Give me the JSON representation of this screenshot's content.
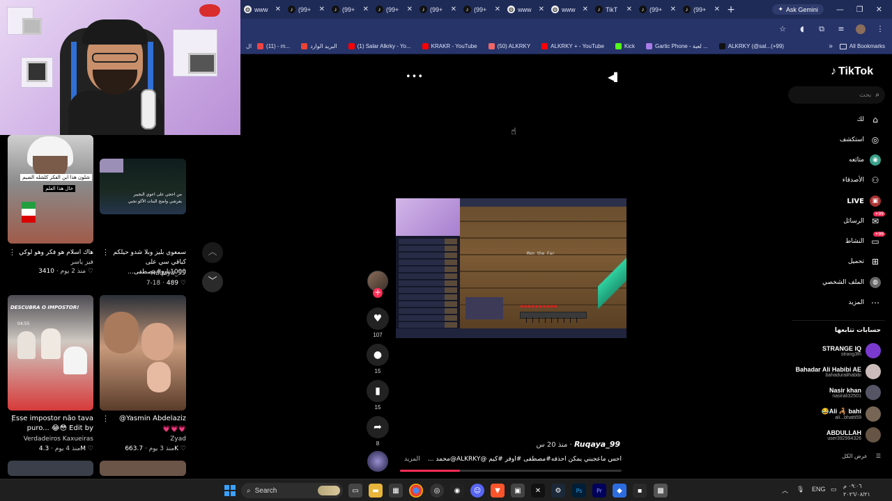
{
  "browser": {
    "tabs": [
      {
        "title": "www",
        "icon": "globe-icon"
      },
      {
        "title": "(99+",
        "icon": "tiktok-icon"
      },
      {
        "title": "(99+",
        "icon": "tiktok-icon"
      },
      {
        "title": "(99+",
        "icon": "tiktok-icon"
      },
      {
        "title": "(99+",
        "icon": "tiktok-icon"
      },
      {
        "title": "(99+",
        "icon": "tiktok-icon"
      },
      {
        "title": "www",
        "icon": "globe-icon"
      },
      {
        "title": "www",
        "icon": "globe-icon"
      },
      {
        "title": "TikT",
        "icon": "tiktok-icon"
      },
      {
        "title": "(99+",
        "icon": "tiktok-icon"
      },
      {
        "title": "(99+",
        "icon": "tiktok-icon"
      }
    ],
    "ask_gemini": "Ask Gemini",
    "bookmarks": [
      {
        "label": "(11) - m...",
        "color": "#e44"
      },
      {
        "label": "البريد الوارد",
        "color": "#ea4335"
      },
      {
        "label": "(1) Salar Alkrky - Yo...",
        "color": "#f00"
      },
      {
        "label": "KRAKR - YouTube",
        "color": "#f00"
      },
      {
        "label": "(50) ALKRKY",
        "color": "#e66"
      },
      {
        "label": "ALKRKY + - YouTube",
        "color": "#f00"
      },
      {
        "label": "Kick",
        "color": "#53fc18"
      },
      {
        "label": "Gartic Phone - لعبة ...",
        "color": "#a97be8"
      },
      {
        "label": "ALKRKY (@sal...(+99)",
        "color": "#111"
      }
    ],
    "all_bookmarks": "All Bookmarks"
  },
  "left_feed": {
    "cards": [
      {
        "thumb_text": [
          "شلون هذا ابن الفكر كلشله الضيم",
          "خال هذا العلم"
        ],
        "caption": "هاك اسلام هو فكر وهو لوكي",
        "sub": "فيز ياسر",
        "likes": "3410",
        "age": "منذ 2 يوم"
      },
      {
        "thumb_text": [
          "من احجي على اعوي البجيبر",
          "بفرشي واضح البنات الأكو نجبي"
        ],
        "caption": "سمعوي بليز وبلا شدو حيلكم كباقي سي على 1000تابع#مصطفى...",
        "author": "Ruqaya_99",
        "likes": "489",
        "age": "7-18"
      },
      {
        "thumb_text": [
          "DESCUBRA O IMPOSTOR!",
          "04:55"
        ],
        "caption": "Esse impostor não tava puro... 😂😳 Edit by",
        "author": "Verdadeiros Kaxueiras",
        "likes": "4.3M",
        "age": "منذ 4 يوم"
      },
      {
        "thumb_text": [],
        "caption": "Yasmin Abdelaziz@",
        "sub": "💗💗💗",
        "author": "Zyad",
        "likes": "663.7K",
        "age": "منذ 3 يوم"
      }
    ]
  },
  "video": {
    "game_text": "Mon the Far",
    "counts": {
      "likes": "107",
      "comments": "15",
      "saves": "15",
      "shares": "8"
    },
    "author": "Ruqaya_99",
    "age": "منذ 20 س",
    "caption": "احس ماعجبني يمكن احذفه#مصطفى #اوفر #كيم @ALKRKY@محمد ...",
    "more": "المزيد",
    "progress": 0.27
  },
  "tiktok_sidebar": {
    "logo": "TikTok",
    "search_placeholder": "بحث",
    "nav": [
      {
        "label": "لك",
        "icon": "home-icon"
      },
      {
        "label": "استكشف",
        "icon": "compass-icon"
      },
      {
        "label": "متابَعه",
        "icon": "following-icon"
      },
      {
        "label": "الأصدقاء",
        "icon": "friends-icon"
      },
      {
        "label": "LIVE",
        "icon": "live-icon"
      },
      {
        "label": "الرسائل",
        "icon": "messages-icon",
        "badge": "99+"
      },
      {
        "label": "النشاط",
        "icon": "activity-icon",
        "badge": "99+"
      },
      {
        "label": "تحميل",
        "icon": "upload-icon"
      },
      {
        "label": "الملف الشخصي",
        "icon": "profile-icon"
      },
      {
        "label": "المزيد",
        "icon": "more-icon"
      }
    ],
    "following_title": "حسابات تتابعها",
    "following": [
      {
        "name": "STRANGE IQ",
        "handle": "strang3fn",
        "color": "#7a3ad0"
      },
      {
        "name": "Bahadar Ali Habibi AE",
        "handle": "bahaduralihabibi",
        "color": "#cbb"
      },
      {
        "name": "Nasir khan",
        "handle": "nasirali32501",
        "color": "#556"
      },
      {
        "name": "😂Ali 🦂 bahi",
        "handle": "ali...bhatti59",
        "color": "#765"
      },
      {
        "name": "ABDULLAH",
        "handle": "user392994326",
        "color": "#654"
      }
    ],
    "see_all": "عرض الكل"
  },
  "taskbar": {
    "search": "Search",
    "lang": "ENG",
    "time": "٠٩:٠٦ م",
    "date": "٢٠٢٦/٠٨/٢١"
  }
}
